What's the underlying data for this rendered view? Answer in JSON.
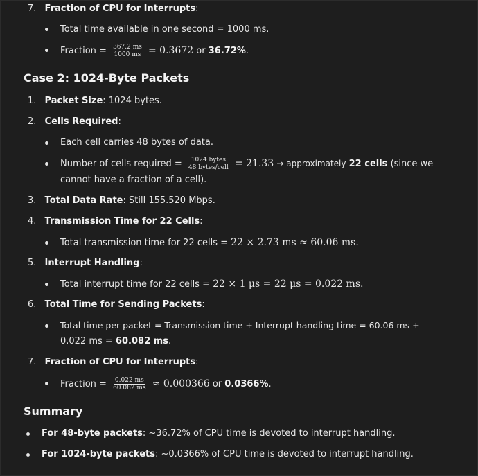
{
  "case1_item7": {
    "num": "7.",
    "title": "Fraction of CPU for Interrupts",
    "colon": ":",
    "b1": "Total time available in one second = 1000 ms.",
    "b2_prefix": "Fraction =",
    "b2_num": "367.2 ms",
    "b2_den": "1000 ms",
    "b2_eq": "= 0.3672",
    "b2_or": "or",
    "b2_bold": "36.72%",
    "b2_end": "."
  },
  "case2": {
    "heading": "Case 2: 1024-Byte Packets",
    "i1_num": "1.",
    "i1_bold": "Packet Size",
    "i1_text": ": 1024 bytes.",
    "i2_num": "2.",
    "i2_bold": "Cells Required",
    "i2_text": ":",
    "i2_b1": "Each cell carries 48 bytes of data.",
    "i2_b2_prefix": "Number of cells required =",
    "i2_b2_num": "1024 bytes",
    "i2_b2_den": "48 bytes/cell",
    "i2_b2_eq": "= 21.33",
    "i2_b2_mid": "→ approximately",
    "i2_b2_bold": "22 cells",
    "i2_b2_rest": "(since we",
    "i2_b2_line2": "cannot have a fraction of a cell).",
    "i3_num": "3.",
    "i3_bold": "Total Data Rate",
    "i3_text": ": Still 155.520 Mbps.",
    "i4_num": "4.",
    "i4_bold": "Transmission Time for 22 Cells",
    "i4_text": ":",
    "i4_b1_text": "Total transmission time for 22 cells =",
    "i4_b1_math": "22 × 2.73 ms ≈ 60.06 ms.",
    "i5_num": "5.",
    "i5_bold": "Interrupt Handling",
    "i5_text": ":",
    "i5_b1_text": "Total interrupt time for 22 cells =",
    "i5_b1_math": "22 × 1 μs = 22 μs = 0.022 ms.",
    "i6_num": "6.",
    "i6_bold": "Total Time for Sending Packets",
    "i6_text": ":",
    "i6_b1_line1": "Total time per packet = Transmission time + Interrupt handling time = 60.06 ms +",
    "i6_b1_line2_pre": "0.022 ms =",
    "i6_b1_line2_bold": "60.082 ms",
    "i6_b1_line2_end": ".",
    "i7_num": "7.",
    "i7_bold": "Fraction of CPU for Interrupts",
    "i7_text": ":",
    "i7_b1_prefix": "Fraction =",
    "i7_b1_num": "0.022 ms",
    "i7_b1_den": "60.082 ms",
    "i7_b1_eq": "≈ 0.000366",
    "i7_b1_or": "or",
    "i7_b1_bold": "0.0366%",
    "i7_b1_end": "."
  },
  "summary": {
    "heading": "Summary",
    "s1_bold": "For 48-byte packets",
    "s1_text": ": ~36.72% of CPU time is devoted to interrupt handling.",
    "s2_bold": "For 1024-byte packets",
    "s2_text": ": ~0.0366% of CPU time is devoted to interrupt handling."
  }
}
